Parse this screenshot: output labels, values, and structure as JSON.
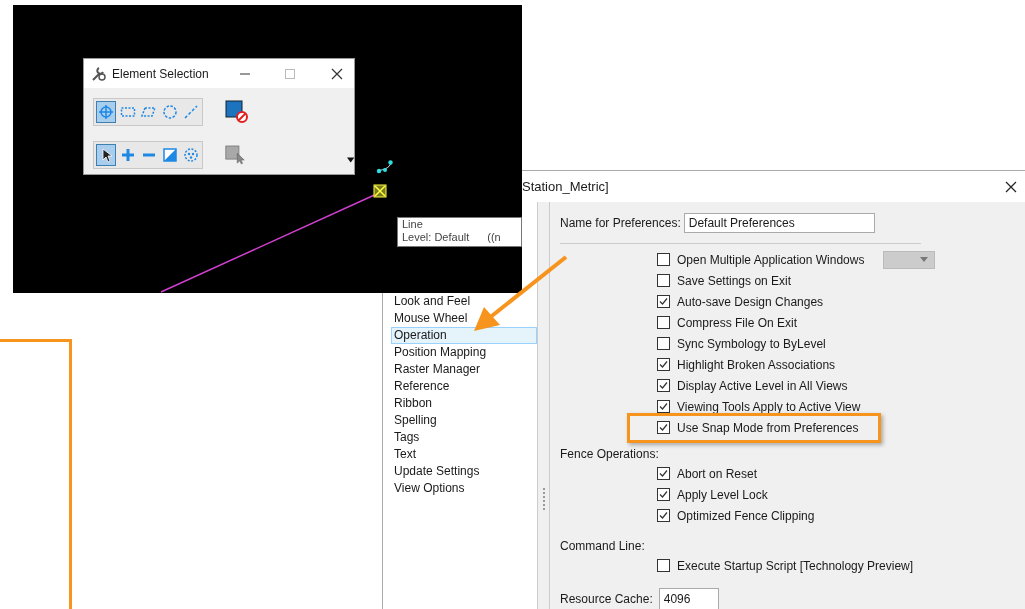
{
  "cad_view": {
    "tooltip": {
      "title": "Line",
      "level": "Level: Default",
      "extra": "((n"
    }
  },
  "element_selection": {
    "title": "Element Selection",
    "method_tools": [
      {
        "kind": "individual",
        "selected": true
      },
      {
        "kind": "block",
        "selected": false
      },
      {
        "kind": "shape",
        "selected": false
      },
      {
        "kind": "circle",
        "selected": false
      },
      {
        "kind": "line",
        "selected": false
      }
    ],
    "mode_tools": [
      {
        "kind": "new",
        "selected": true
      },
      {
        "kind": "add",
        "selected": false
      },
      {
        "kind": "subtract",
        "selected": false
      },
      {
        "kind": "invert",
        "selected": false
      },
      {
        "kind": "clear",
        "selected": false
      }
    ]
  },
  "preferences": {
    "title": "Station_Metric]",
    "categories": [
      {
        "label": "Look and Feel",
        "selected": false
      },
      {
        "label": "Mouse Wheel",
        "selected": false
      },
      {
        "label": "Operation",
        "selected": true
      },
      {
        "label": "Position Mapping",
        "selected": false
      },
      {
        "label": "Raster Manager",
        "selected": false
      },
      {
        "label": "Reference",
        "selected": false
      },
      {
        "label": "Ribbon",
        "selected": false
      },
      {
        "label": "Spelling",
        "selected": false
      },
      {
        "label": "Tags",
        "selected": false
      },
      {
        "label": "Text",
        "selected": false
      },
      {
        "label": "Update Settings",
        "selected": false
      },
      {
        "label": "View Options",
        "selected": false
      }
    ],
    "name_label": "Name for Preferences:",
    "name_value": "Default Preferences",
    "general_options": [
      {
        "label": "Open Multiple Application Windows",
        "checked": false,
        "kind": "with_dropdown",
        "highlighted": false
      },
      {
        "label": "Save Settings on Exit",
        "checked": false,
        "kind": "plain",
        "highlighted": false
      },
      {
        "label": "Auto-save Design Changes",
        "checked": true,
        "kind": "plain",
        "highlighted": false
      },
      {
        "label": "Compress File On Exit",
        "checked": false,
        "kind": "plain",
        "highlighted": false
      },
      {
        "label": "Sync Symbology to ByLevel",
        "checked": false,
        "kind": "plain",
        "highlighted": false
      },
      {
        "label": "Highlight Broken Associations",
        "checked": true,
        "kind": "plain",
        "highlighted": false
      },
      {
        "label": "Display Active Level in All Views",
        "checked": true,
        "kind": "plain",
        "highlighted": false
      },
      {
        "label": "Viewing Tools Apply to Active View",
        "checked": true,
        "kind": "plain",
        "highlighted": false
      },
      {
        "label": "Use Snap Mode from Preferences",
        "checked": true,
        "kind": "plain",
        "highlighted": true
      }
    ],
    "fence_operations": {
      "heading": "Fence Operations:",
      "options": [
        {
          "label": "Abort on Reset",
          "checked": true
        },
        {
          "label": "Apply Level Lock",
          "checked": true
        },
        {
          "label": "Optimized Fence Clipping",
          "checked": true
        }
      ]
    },
    "command_line": {
      "heading": "Command Line:",
      "options": [
        {
          "label": "Execute Startup Script [Technology Preview]",
          "checked": false
        }
      ]
    },
    "resource_cache": {
      "label": "Resource Cache:",
      "value": "4096"
    }
  }
}
